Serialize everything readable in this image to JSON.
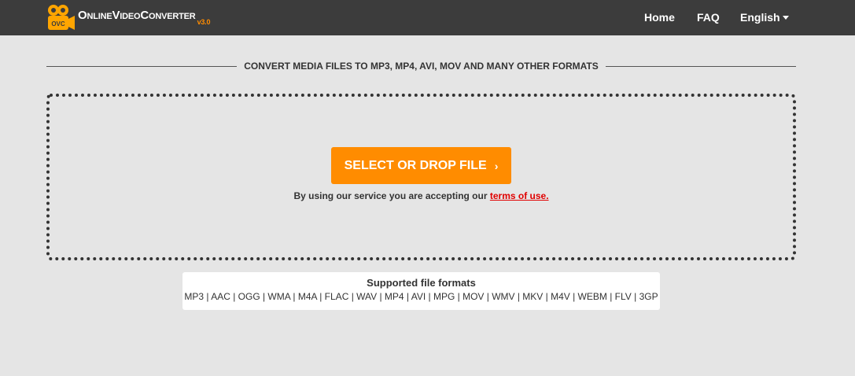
{
  "nav": {
    "brand_o": "O",
    "brand_nline": "NLINE",
    "brand_v": "V",
    "brand_ideo": "IDEO",
    "brand_c": "C",
    "brand_onverter": "ONVERTER",
    "brand_version": "v3.0",
    "logo_text": "OVC",
    "home": "Home",
    "faq": "FAQ",
    "language": "English"
  },
  "colors": {
    "navbar": "#3c3c3c",
    "accent": "#ff8c00",
    "background": "#e5e5e5",
    "link": "#e00000"
  },
  "main": {
    "heading": "CONVERT MEDIA FILES TO MP3, MP4, AVI, MOV AND MANY OTHER FORMATS",
    "select_button": "SELECT OR DROP FILE",
    "select_chevron": "›",
    "terms_prefix": "By using our service you are accepting our ",
    "terms_link": "terms of use."
  },
  "formats": {
    "title": "Supported file formats",
    "list": "MP3 | AAC | OGG | WMA | M4A | FLAC | WAV | MP4 | AVI | MPG | MOV | WMV | MKV | M4V | WEBM | FLV | 3GP"
  }
}
